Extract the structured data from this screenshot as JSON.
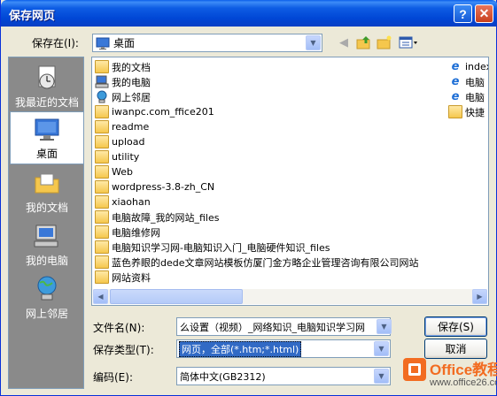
{
  "window": {
    "title": "保存网页"
  },
  "save_in": {
    "label": "保存在(I):",
    "value": "桌面"
  },
  "places": [
    {
      "label": "我最近的文档"
    },
    {
      "label": "桌面"
    },
    {
      "label": "我的文档"
    },
    {
      "label": "我的电脑"
    },
    {
      "label": "网上邻居"
    }
  ],
  "files": [
    {
      "name": "我的文档",
      "icon": "documents-icon"
    },
    {
      "name": "我的电脑",
      "icon": "computer-icon"
    },
    {
      "name": "网上邻居",
      "icon": "network-icon"
    },
    {
      "name": "iwanpc.com_ffice201",
      "icon": "folder-icon"
    },
    {
      "name": "readme",
      "icon": "folder-icon"
    },
    {
      "name": "upload",
      "icon": "folder-icon"
    },
    {
      "name": "utility",
      "icon": "folder-icon"
    },
    {
      "name": "Web",
      "icon": "folder-icon"
    },
    {
      "name": "wordpress-3.8-zh_CN",
      "icon": "folder-icon"
    },
    {
      "name": "xiaohan",
      "icon": "folder-icon"
    },
    {
      "name": "电脑故障_我的网站_files",
      "icon": "folder-icon"
    },
    {
      "name": "电脑维修网",
      "icon": "folder-icon"
    },
    {
      "name": "电脑知识学习网-电脑知识入门_电脑硬件知识_files",
      "icon": "folder-icon"
    },
    {
      "name": "蓝色养眼的dede文章网站模板仿厦门金方略企业管理咨询有限公司网站",
      "icon": "folder-icon"
    },
    {
      "name": "网站资料",
      "icon": "folder-icon"
    }
  ],
  "files_right": [
    {
      "name": "index",
      "icon": "ie-file-icon"
    },
    {
      "name": "电脑",
      "icon": "ie-file-icon"
    },
    {
      "name": "电脑",
      "icon": "ie-file-icon"
    },
    {
      "name": "快捷",
      "icon": "shortcut-folder-icon"
    }
  ],
  "filename": {
    "label": "文件名(N):",
    "value": "么设置（视频）_网络知识_电脑知识学习网"
  },
  "filetype": {
    "label": "保存类型(T):",
    "value": "网页，全部(*.htm;*.html)"
  },
  "encoding": {
    "label": "编码(E):",
    "value": "简体中文(GB2312)"
  },
  "buttons": {
    "save": "保存(S)",
    "cancel": "取消"
  },
  "watermark": {
    "brand": "Office教程网",
    "url": "www.office26.com"
  },
  "colors": {
    "titlebar": "#0054E3",
    "dialog_bg": "#ECE9D8",
    "selection": "#316AC5",
    "logo_orange": "#F26C21"
  }
}
